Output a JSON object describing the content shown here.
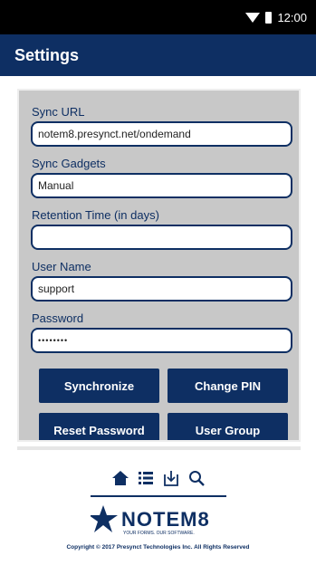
{
  "status_bar": {
    "time": "12:00"
  },
  "header": {
    "title": "Settings"
  },
  "form": {
    "sync_url": {
      "label": "Sync URL",
      "value": "notem8.presynct.net/ondemand"
    },
    "sync_gadgets": {
      "label": "Sync Gadgets",
      "value": "Manual"
    },
    "retention": {
      "label": "Retention Time (in days)",
      "value": ""
    },
    "user_name": {
      "label": "User Name",
      "value": "support"
    },
    "password": {
      "label": "Password",
      "value": "••••••••"
    }
  },
  "buttons": {
    "synchronize": "Synchronize",
    "change_pin": "Change PIN",
    "reset_password": "Reset Password",
    "user_group": "User Group"
  },
  "footer": {
    "nav_icons": [
      "home-icon",
      "list-icon",
      "download-icon",
      "search-icon"
    ],
    "logo_text": "NOTEM8",
    "logo_tagline": "YOUR FORMS. OUR SOFTWARE.",
    "copyright": "Copyright © 2017 Presynct Technologies Inc. All Rights Reserved"
  },
  "colors": {
    "brand": "#0e2f63",
    "panel": "#c8c8c8",
    "status_bar": "#000000"
  }
}
